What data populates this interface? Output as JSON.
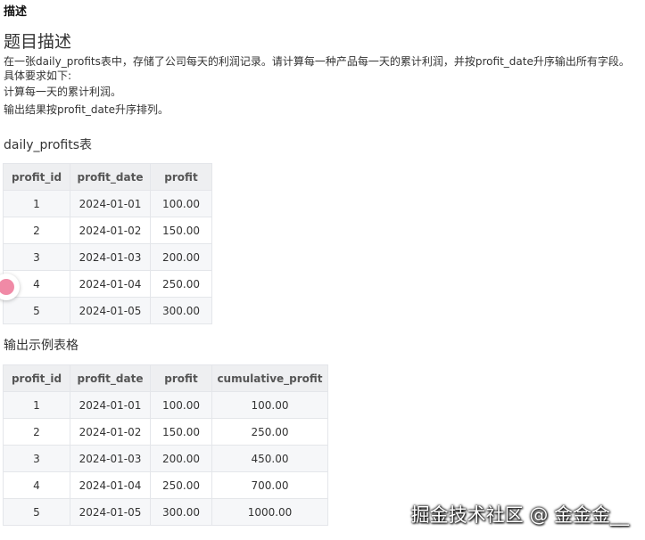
{
  "section_label": "描述",
  "problem": {
    "title": "题目描述",
    "lines": [
      "在一张daily_profits表中，存储了公司每天的利润记录。请计算每一种产品每一天的累计利润，并按profit_date升序输出所有字段。",
      "具体要求如下:",
      "计算每一天的累计利润。",
      "输出结果按profit_date升序排列。"
    ]
  },
  "input_table": {
    "title": "daily_profits表",
    "headers": [
      "profit_id",
      "profit_date",
      "profit"
    ],
    "rows": [
      [
        "1",
        "2024-01-01",
        "100.00"
      ],
      [
        "2",
        "2024-01-02",
        "150.00"
      ],
      [
        "3",
        "2024-01-03",
        "200.00"
      ],
      [
        "4",
        "2024-01-04",
        "250.00"
      ],
      [
        "5",
        "2024-01-05",
        "300.00"
      ]
    ]
  },
  "output_table": {
    "title": "输出示例表格",
    "headers": [
      "profit_id",
      "profit_date",
      "profit",
      "cumulative_profit"
    ],
    "rows": [
      [
        "1",
        "2024-01-01",
        "100.00",
        "100.00"
      ],
      [
        "2",
        "2024-01-02",
        "150.00",
        "250.00"
      ],
      [
        "3",
        "2024-01-03",
        "200.00",
        "450.00"
      ],
      [
        "4",
        "2024-01-04",
        "250.00",
        "700.00"
      ],
      [
        "5",
        "2024-01-05",
        "300.00",
        "1000.00"
      ]
    ]
  },
  "watermark": "掘金技术社区 @ 金金金__",
  "colors": {
    "header_bg": "#eeeff1",
    "stripe_bg": "#f6f7f9",
    "border": "#e4e6ea",
    "badge_accent": "#f08aa6"
  }
}
